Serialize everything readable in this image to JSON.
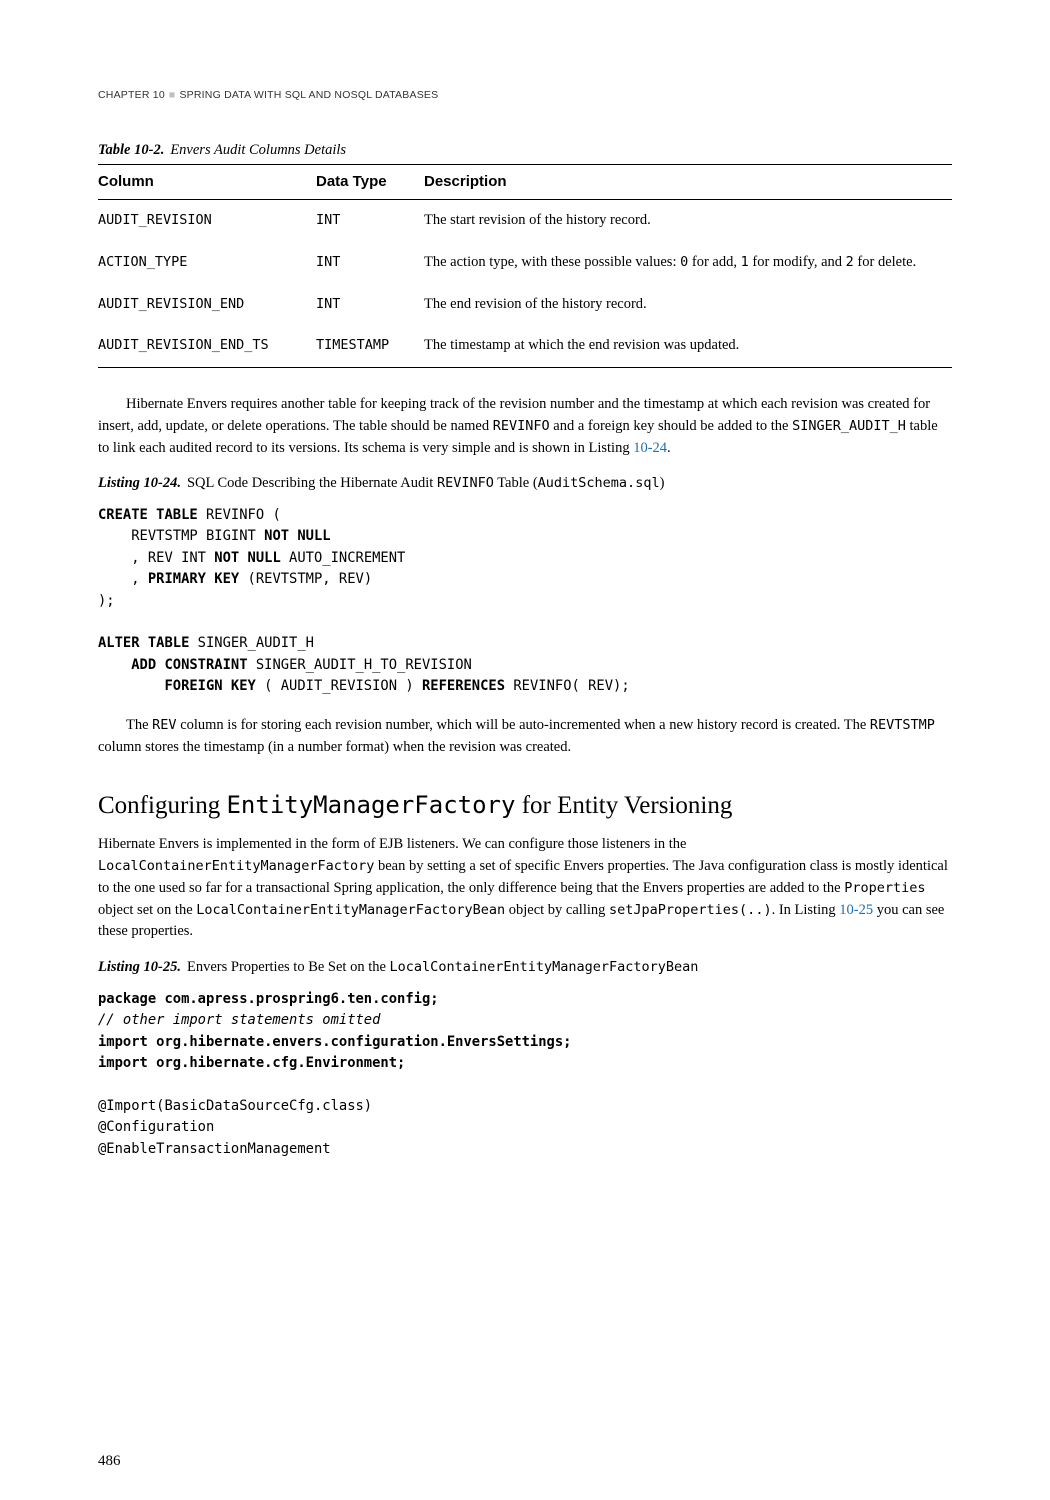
{
  "runningHead": {
    "left": "CHAPTER 10",
    "right": "SPRING DATA WITH SQL AND NOSQL DATABASES"
  },
  "table": {
    "label": "Table 10-2.",
    "caption": "Envers Audit Columns Details",
    "headers": [
      "Column",
      "Data Type",
      "Description"
    ],
    "rows": [
      {
        "col": "AUDIT_REVISION",
        "type": "INT",
        "desc_pre": "The start revision of the history record.",
        "desc_mid": "",
        "desc_post": ""
      },
      {
        "col": "ACTION_TYPE",
        "type": "INT",
        "desc_pre": "The action type, with these possible values: ",
        "desc_mid": "0 for add, 1 for modify, and 2 for delete",
        "desc_post": "."
      },
      {
        "col": "AUDIT_REVISION_END",
        "type": "INT",
        "desc_pre": "The end revision of the history record.",
        "desc_mid": "",
        "desc_post": ""
      },
      {
        "col": "AUDIT_REVISION_END_TS",
        "type": "TIMESTAMP",
        "desc_pre": "The timestamp at which the end revision was updated.",
        "desc_mid": "",
        "desc_post": ""
      }
    ]
  },
  "para1": {
    "t1": "Hibernate Envers requires another table for keeping track of the revision number and the timestamp at which each revision was created for insert, add, update, or delete operations. The table should be named ",
    "c1": "REVINFO",
    "t2": " and a foreign key should be added to the ",
    "c2": "SINGER_AUDIT_H",
    "t3": " table to link each audited record to its versions. Its schema is very simple and is shown in Listing ",
    "link": "10-24",
    "t4": "."
  },
  "listing24": {
    "label": "Listing 10-24.",
    "t1": "SQL Code Describing the Hibernate Audit ",
    "c1": "REVINFO",
    "t2": " Table (",
    "c2": "AuditSchema.sql",
    "t3": ")"
  },
  "code1": {
    "l1a": "CREATE TABLE",
    "l1b": " REVINFO (",
    "l2a": "    REVTSTMP BIGINT ",
    "l2b": "NOT NULL",
    "l3a": "    , REV INT ",
    "l3b": "NOT NULL",
    "l3c": " AUTO_INCREMENT",
    "l4a": "    , ",
    "l4b": "PRIMARY KEY",
    "l4c": " (REVTSTMP, REV)",
    "l5": ");",
    "blank": "",
    "l6a": "ALTER TABLE",
    "l6b": " SINGER_AUDIT_H",
    "l7a": "    ",
    "l7b": "ADD CONSTRAINT",
    "l7c": " SINGER_AUDIT_H_TO_REVISION",
    "l8a": "        ",
    "l8b": "FOREIGN KEY",
    "l8c": " ( AUDIT_REVISION ) ",
    "l8d": "REFERENCES",
    "l8e": " REVINFO( REV);"
  },
  "para2": {
    "t1": "The ",
    "c1": "REV",
    "t2": " column is for storing each revision number, which will be auto-incremented when a new history record is created. The ",
    "c2": "REVTSTMP",
    "t3": " column stores the timestamp (in a number format) when the revision was created."
  },
  "section": {
    "pre": "Configuring ",
    "mono": "EntityManagerFactory",
    "post": " for Entity Versioning"
  },
  "para3": {
    "t1": "Hibernate Envers is implemented in the form of EJB listeners. We can configure those listeners in the ",
    "c1": "LocalContainerEntityManagerFactory",
    "t2": " bean by setting a set of specific Envers properties. The Java configuration class is mostly identical to the one used so far for a transactional Spring application, the only difference being that the Envers properties are added to the ",
    "c2": "Properties",
    "t3": " object set on the ",
    "c3": "LocalContainerEntityManagerFactoryBean",
    "t4": " object by calling ",
    "c4": "setJpaProperties(..)",
    "t5": ". In Listing ",
    "link": "10-25",
    "t6": " you can see these properties."
  },
  "listing25": {
    "label": "Listing 10-25.",
    "t1": "Envers Properties to Be Set on the ",
    "c1": "LocalContainerEntityManagerFactoryBean"
  },
  "code2": {
    "l1": "package com.apress.prospring6.ten.config;",
    "l2": "// other import statements omitted",
    "l3": "import org.hibernate.envers.configuration.EnversSettings;",
    "l4": "import org.hibernate.cfg.Environment;",
    "blank": "",
    "l5": "@Import(BasicDataSourceCfg.class)",
    "l6": "@Configuration",
    "l7": "@EnableTransactionManagement"
  },
  "pageNumber": "486"
}
